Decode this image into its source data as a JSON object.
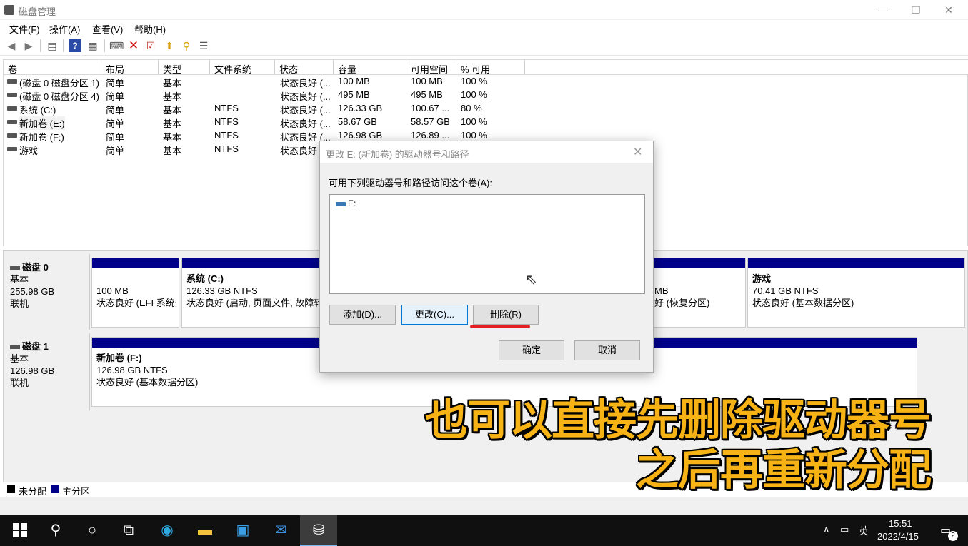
{
  "window": {
    "title": "磁盘管理",
    "min": "—",
    "max": "❐",
    "close": "✕"
  },
  "menu": [
    "文件(F)",
    "操作(A)",
    "查看(V)",
    "帮助(H)"
  ],
  "toolbar": [
    "arrow-left-icon",
    "arrow-right-icon",
    "properties-icon",
    "help-icon",
    "view-icon",
    "connect-icon",
    "delete-icon",
    "check-icon",
    "import-icon",
    "search-icon",
    "list-icon"
  ],
  "columns": [
    "卷",
    "布局",
    "类型",
    "文件系统",
    "状态",
    "容量",
    "可用空间",
    "% 可用"
  ],
  "volumes": [
    {
      "name": "(磁盘 0 磁盘分区 1)",
      "layout": "简单",
      "type": "基本",
      "fs": "",
      "status": "状态良好 (...",
      "capacity": "100 MB",
      "free": "100 MB",
      "pct": "100 %"
    },
    {
      "name": "(磁盘 0 磁盘分区 4)",
      "layout": "简单",
      "type": "基本",
      "fs": "",
      "status": "状态良好 (...",
      "capacity": "495 MB",
      "free": "495 MB",
      "pct": "100 %"
    },
    {
      "name": "系统 (C:)",
      "layout": "简单",
      "type": "基本",
      "fs": "NTFS",
      "status": "状态良好 (...",
      "capacity": "126.33 GB",
      "free": "100.67 ...",
      "pct": "80 %"
    },
    {
      "name": "新加卷 (E:)",
      "layout": "简单",
      "type": "基本",
      "fs": "NTFS",
      "status": "状态良好 (...",
      "capacity": "58.67 GB",
      "free": "58.57 GB",
      "pct": "100 %"
    },
    {
      "name": "新加卷 (F:)",
      "layout": "简单",
      "type": "基本",
      "fs": "NTFS",
      "status": "状态良好 (...",
      "capacity": "126.98 GB",
      "free": "126.89 ...",
      "pct": "100 %"
    },
    {
      "name": "游戏",
      "layout": "简单",
      "type": "基本",
      "fs": "NTFS",
      "status": "状态良好 (...",
      "capacity": "",
      "free": "",
      "pct": ""
    }
  ],
  "disks": [
    {
      "name": "磁盘 0",
      "type": "基本",
      "size": "255.98 GB",
      "state": "联机",
      "parts": [
        {
          "title": "",
          "size": "100 MB",
          "status": "状态良好 (EFI 系统分"
        },
        {
          "title": "系统  (C:)",
          "size": "126.33 GB NTFS",
          "status": "状态良好 (启动, 页面文件, 故障转"
        },
        {
          "title": "",
          "size": "MB",
          "status": "好 (恢复分区)"
        },
        {
          "title": "游戏",
          "size": "70.41 GB NTFS",
          "status": "状态良好 (基本数据分区)"
        }
      ]
    },
    {
      "name": "磁盘 1",
      "type": "基本",
      "size": "126.98 GB",
      "state": "联机",
      "parts": [
        {
          "title": "新加卷  (F:)",
          "size": "126.98 GB NTFS",
          "status": "状态良好 (基本数据分区)"
        }
      ]
    }
  ],
  "legend": {
    "unallocated": "未分配",
    "primary": "主分区",
    "unallocated_color": "#000000",
    "primary_color": "#00008b"
  },
  "dialog": {
    "title": "更改 E: (新加卷) 的驱动器号和路径",
    "prompt": "可用下列驱动器号和路径访问这个卷(A):",
    "entry": "E:",
    "add": "添加(D)...",
    "change": "更改(C)...",
    "remove": "删除(R)",
    "ok": "确定",
    "cancel": "取消"
  },
  "caption": {
    "line1": "也可以直接先删除驱动器号",
    "line2": "之后再重新分配",
    "color": "#f7b316"
  },
  "taskbar": {
    "icons": [
      "windows-start-icon",
      "search-icon",
      "cortana-icon",
      "task-view-icon",
      "edge-icon",
      "file-explorer-icon",
      "store-icon",
      "mail-icon",
      "disk-management-icon"
    ],
    "ime": "英",
    "time": "15:51",
    "date": "2022/4/15",
    "notifications": "2"
  }
}
